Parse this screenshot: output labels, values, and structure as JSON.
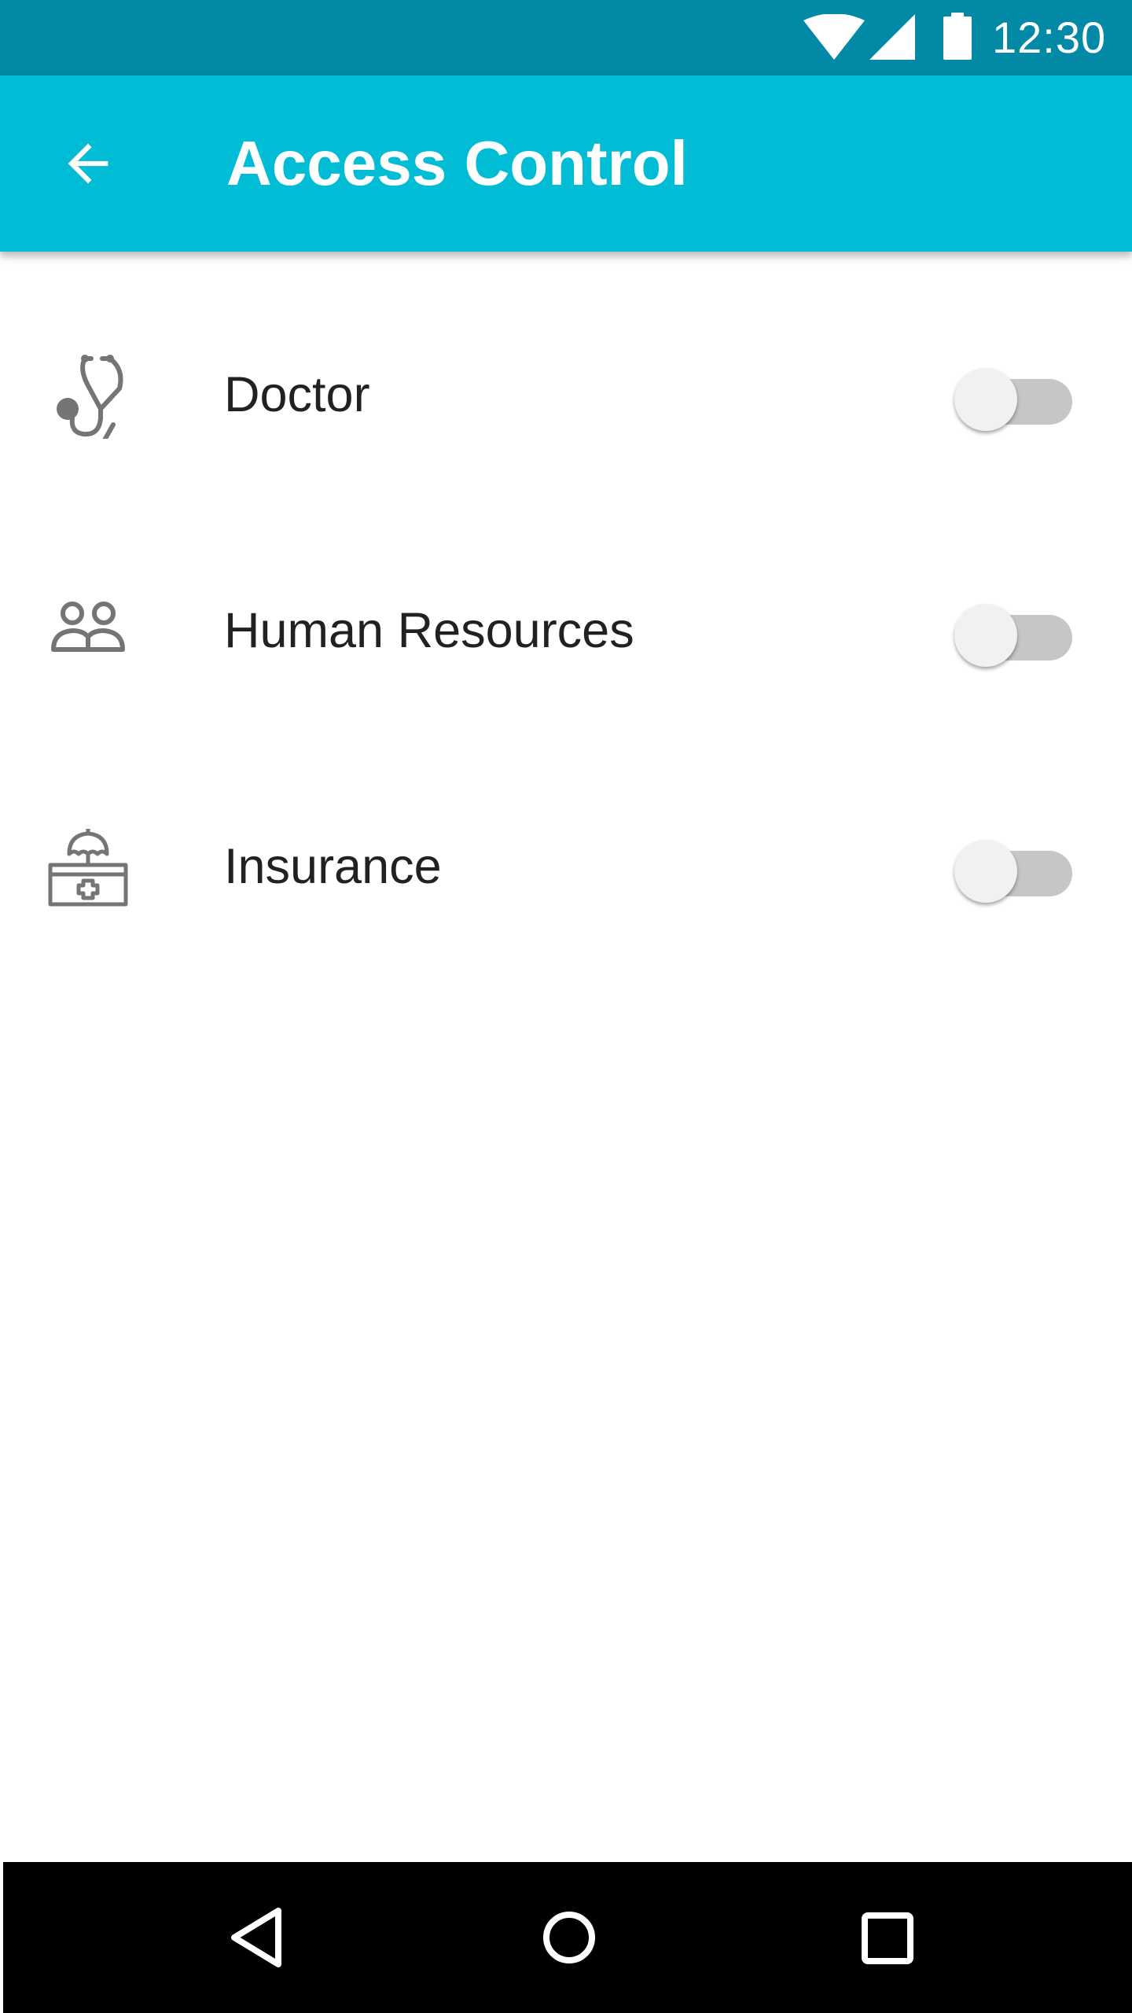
{
  "status_bar": {
    "time": "12:30",
    "icons": [
      "wifi-icon",
      "signal-icon",
      "battery-icon"
    ]
  },
  "app_bar": {
    "title": "Access Control",
    "back_icon": "arrow-back-icon",
    "background_color": "#00bcd4"
  },
  "access_list": {
    "items": [
      {
        "label": "Doctor",
        "icon": "stethoscope-icon",
        "enabled": false
      },
      {
        "label": "Human Resources",
        "icon": "people-icon",
        "enabled": false
      },
      {
        "label": "Insurance",
        "icon": "insurance-kit-icon",
        "enabled": false
      }
    ]
  },
  "nav_bar": {
    "buttons": [
      "nav-back-icon",
      "nav-home-icon",
      "nav-recents-icon"
    ]
  },
  "colors": {
    "status_bar": "#0289a5",
    "accent": "#00bcd4",
    "icon_gray": "#757575",
    "toggle_track_off": "#c6c6c6",
    "toggle_thumb_off": "#f1f1f1"
  }
}
